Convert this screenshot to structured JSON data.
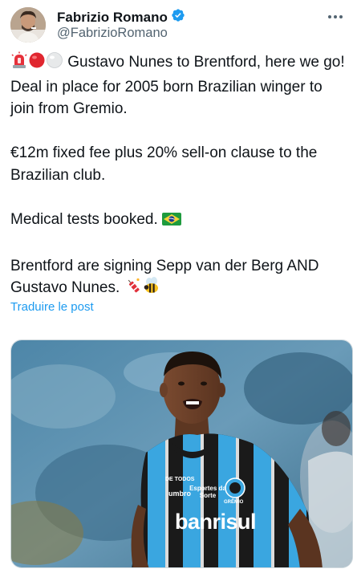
{
  "author": {
    "name": "Fabrizio Romano",
    "handle": "@FabrizioRomano",
    "verified": true,
    "verified_color": "#1d9bf0"
  },
  "tweet": {
    "p1": "Gustavo Nunes to Brentford, here we go! Deal in place for 2005 born Brazilian winger to join from Gremio.",
    "p2": "€12m fixed fee plus 20% sell-on clause to the Brazilian club.",
    "p3": "Medical tests booked.",
    "p4": "Brentford are signing Sepp van der Berg AND Gustavo Nunes.",
    "emojis": [
      "siren-icon",
      "red-circle-icon",
      "white-circle-icon",
      "brazil-flag-icon",
      "firecracker-icon",
      "bee-icon"
    ]
  },
  "translate_label": "Traduire le post",
  "media": {
    "shirt_texts": {
      "sponsor": "banrisul",
      "sleeve": "Esportes da Sorte",
      "brand": "umbro",
      "badge": "GRÊMIO",
      "collar": "DE TODOS"
    }
  },
  "colors": {
    "link": "#1d9bf0",
    "secondary_text": "#536471",
    "primary_text": "#0f1419",
    "jersey_blue": "#3aa6e0"
  }
}
